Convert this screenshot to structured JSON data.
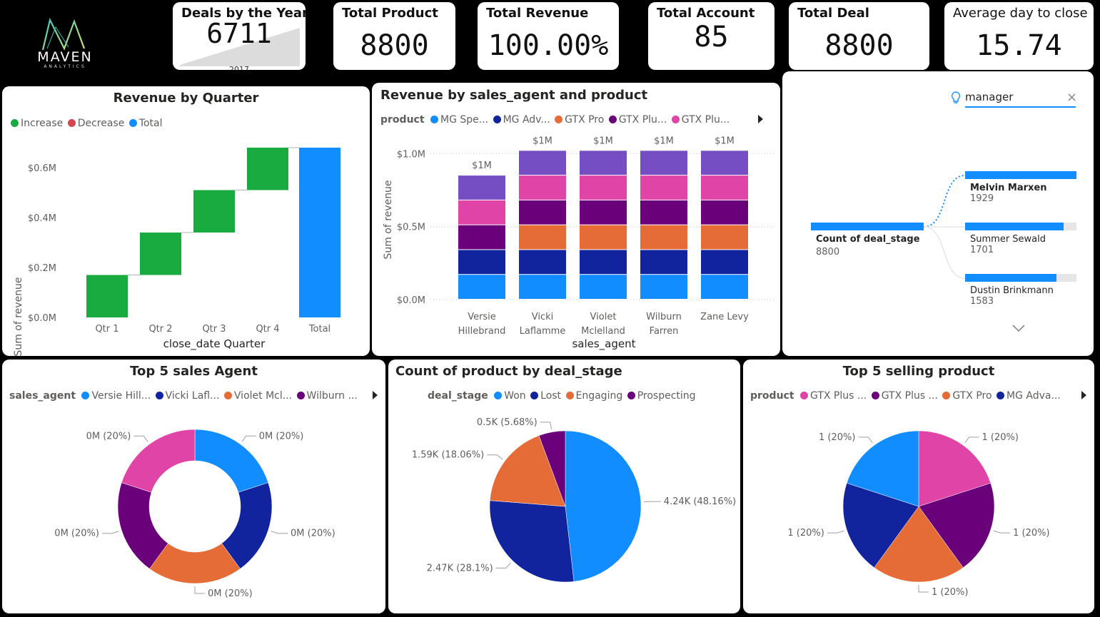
{
  "logo": {
    "name": "MAVEN",
    "sub": "ANALYTICS"
  },
  "kpis": {
    "deals_by_year": {
      "title": "Deals by the Year",
      "value": "6711",
      "year": "2017"
    },
    "total_product": {
      "title": "Total Product",
      "value": "8800"
    },
    "total_revenue": {
      "title": "Total Revenue",
      "value": "100.00%"
    },
    "total_account": {
      "title": "Total Account",
      "value": "85"
    },
    "total_deal": {
      "title": "Total Deal",
      "value": "8800"
    },
    "avg_close": {
      "title": "Average day to close",
      "value": "15.74"
    }
  },
  "colors": {
    "increase": "#1aab40",
    "decrease": "#d64550",
    "total": "#118dff",
    "c1": "#118dff",
    "c2": "#12239e",
    "c3": "#e66c37",
    "c4": "#6b007b",
    "c5": "#e044a7",
    "c6": "#744ec2"
  },
  "waterfall": {
    "title": "Revenue by Quarter",
    "legend": [
      {
        "label": "Increase",
        "color": "#1aab40"
      },
      {
        "label": "Decrease",
        "color": "#d64550"
      },
      {
        "label": "Total",
        "color": "#118dff"
      }
    ],
    "ylabel": "Sum of revenue",
    "xlabel": "close_date Quarter",
    "yticks": [
      "$0.0M",
      "$0.2M",
      "$0.4M",
      "$0.6M"
    ]
  },
  "stacked": {
    "title": "Revenue by sales_agent and product",
    "legend_title": "product",
    "legend": [
      {
        "label": "MG Spe...",
        "color": "#118dff"
      },
      {
        "label": "MG Adv...",
        "color": "#12239e"
      },
      {
        "label": "GTX Pro",
        "color": "#e66c37"
      },
      {
        "label": "GTX Plu...",
        "color": "#6b007b"
      },
      {
        "label": "GTX Plu...",
        "color": "#e044a7"
      }
    ],
    "ylabel": "Sum of revenue",
    "xlabel": "sales_agent",
    "yticks": [
      "$0.0M",
      "$0.5M",
      "$1.0M"
    ],
    "cat_lines": [
      [
        "Versie",
        "Hillebrand"
      ],
      [
        "Vicki",
        "Laflamme"
      ],
      [
        "Violet",
        "Mclelland"
      ],
      [
        "Wilburn",
        "Farren"
      ],
      [
        "Zane Levy"
      ]
    ]
  },
  "decomp": {
    "search": "manager",
    "root_label": "Count of deal_stage",
    "root_value": "8800",
    "items": [
      {
        "name": "Melvin Marxen",
        "value": "1929"
      },
      {
        "name": "Summer Sewald",
        "value": "1701"
      },
      {
        "name": "Dustin Brinkmann",
        "value": "1583"
      }
    ]
  },
  "donut": {
    "title": "Top 5 sales Agent",
    "legend_title": "sales_agent",
    "legend": [
      {
        "label": "Versie Hill...",
        "color": "#118dff"
      },
      {
        "label": "Vicki Lafl...",
        "color": "#12239e"
      },
      {
        "label": "Violet Mcl...",
        "color": "#e66c37"
      },
      {
        "label": "Wilburn ...",
        "color": "#6b007b"
      }
    ],
    "labels": [
      "0M (20%)",
      "0M (20%)",
      "0M (20%)",
      "0M (20%)",
      "0M (20%)"
    ]
  },
  "pie_stage": {
    "title": "Count of product by deal_stage",
    "legend_title": "deal_stage",
    "legend": [
      {
        "label": "Won",
        "color": "#118dff"
      },
      {
        "label": "Lost",
        "color": "#12239e"
      },
      {
        "label": "Engaging",
        "color": "#e66c37"
      },
      {
        "label": "Prospecting",
        "color": "#6b007b"
      }
    ],
    "labels": [
      "4.24K (48.16%)",
      "2.47K (28.1%)",
      "1.59K (18.06%)",
      "0.5K (5.68%)"
    ]
  },
  "pie_product": {
    "title": "Top 5 selling product",
    "legend_title": "product",
    "legend": [
      {
        "label": "GTX Plus ...",
        "color": "#e044a7"
      },
      {
        "label": "GTX Plus ...",
        "color": "#6b007b"
      },
      {
        "label": "GTX Pro",
        "color": "#e66c37"
      },
      {
        "label": "MG Adva...",
        "color": "#12239e"
      }
    ],
    "labels": [
      "1 (20%)",
      "1 (20%)",
      "1 (20%)",
      "1 (20%)",
      "1 (20%)"
    ]
  },
  "chart_data": [
    {
      "type": "bar",
      "subtype": "waterfall",
      "title": "Revenue by Quarter",
      "categories": [
        "Qtr 1",
        "Qtr 2",
        "Qtr 3",
        "Qtr 4",
        "Total"
      ],
      "increments": [
        0.17,
        0.17,
        0.17,
        0.17
      ],
      "total": 0.68,
      "ylim": [
        0,
        0.7
      ],
      "xlabel": "close_date Quarter",
      "ylabel": "Sum of revenue",
      "yticks": [
        "$0.0M",
        "$0.2M",
        "$0.4M",
        "$0.6M"
      ],
      "legend": "top-left"
    },
    {
      "type": "bar",
      "subtype": "stacked",
      "title": "Revenue by sales_agent and product",
      "categories": [
        "Versie Hillebrand",
        "Vicki Laflamme",
        "Violet Mclelland",
        "Wilburn Farren",
        "Zane Levy"
      ],
      "series": [
        {
          "name": "MG Spe...",
          "values": [
            0.17,
            0.17,
            0.17,
            0.17,
            0.17
          ]
        },
        {
          "name": "MG Adv...",
          "values": [
            0.17,
            0.17,
            0.17,
            0.17,
            0.17
          ]
        },
        {
          "name": "GTX Pro",
          "values": [
            0,
            0.17,
            0.17,
            0.17,
            0.17
          ]
        },
        {
          "name": "GTX Plu...",
          "values": [
            0.17,
            0.17,
            0.17,
            0.17,
            0.17
          ]
        },
        {
          "name": "GTX Plu...",
          "values": [
            0.17,
            0.17,
            0.17,
            0.17,
            0.17
          ]
        },
        {
          "name": "",
          "values": [
            0.17,
            0.17,
            0.17,
            0.17,
            0.17
          ]
        }
      ],
      "totals": [
        "$1M",
        "$1M",
        "$1M",
        "$1M",
        "$1M"
      ],
      "ylim": [
        0,
        1.1
      ],
      "xlabel": "sales_agent",
      "ylabel": "Sum of revenue"
    },
    {
      "type": "pie",
      "subtype": "donut",
      "title": "Top 5 sales Agent",
      "labels": [
        "Versie Hill...",
        "Vicki Lafl...",
        "Violet Mcl...",
        "Wilburn ...",
        ""
      ],
      "values": [
        20,
        20,
        20,
        20,
        20
      ]
    },
    {
      "type": "pie",
      "title": "Count of product by deal_stage",
      "labels": [
        "Won",
        "Lost",
        "Engaging",
        "Prospecting"
      ],
      "values": [
        4240,
        2470,
        1590,
        500
      ],
      "percent": [
        48.16,
        28.1,
        18.06,
        5.68
      ]
    },
    {
      "type": "pie",
      "title": "Top 5 selling product",
      "labels": [
        "GTX Plus ...",
        "GTX Plus ...",
        "GTX Pro",
        "MG Adva...",
        ""
      ],
      "values": [
        1,
        1,
        1,
        1,
        1
      ]
    }
  ]
}
